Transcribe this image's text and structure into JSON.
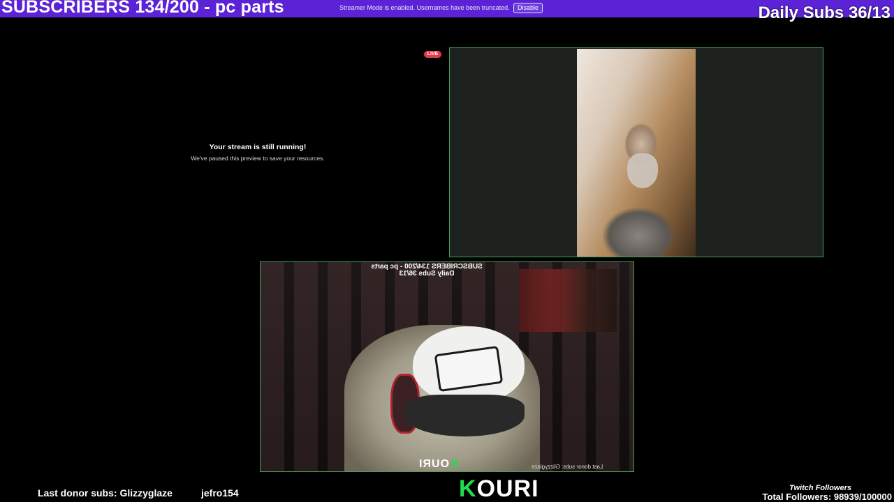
{
  "top_bar": {
    "title": "SUBSCRIBERS 134/200 - pc parts",
    "streamer_notice": "Streamer Mode is enabled. Usernames have been truncated.",
    "disable_label": "Disable",
    "daily_subs": "Daily Subs 36/13"
  },
  "preview": {
    "title": "Your stream is still running!",
    "subtitle": "We've paused this preview to save your resources."
  },
  "live_badge": "LIVE",
  "cam_overlay": {
    "line1": "SUBSCRIBERS 134/200 - pc parts",
    "line2": "Daily Subs 36/13",
    "bottom_left": "Last donor subs: Glizzyglaze",
    "brand_k": "K",
    "brand_rest": "OURI"
  },
  "footer": {
    "last_donor": "Last donor subs: Glizzyglaze",
    "last_name": "jefro154",
    "brand_k": "K",
    "brand_rest": "OURI",
    "twitch_followers_label": "Twitch Followers",
    "total_followers": "Total Followers: 98939/100000"
  },
  "colors": {
    "top_bar": "#5b22d6",
    "tile_border": "#43a35c",
    "live_badge": "#e8394a",
    "brand_green": "#1fe04a"
  }
}
